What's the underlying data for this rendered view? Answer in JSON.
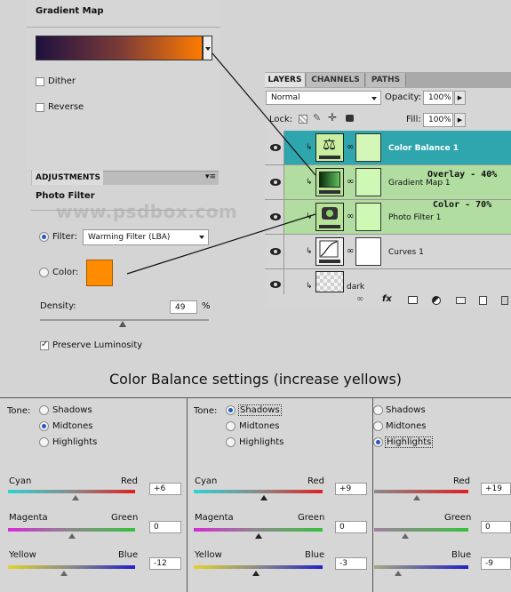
{
  "gradient_map": {
    "title": "Gradient Map",
    "dither_label": "Dither",
    "reverse_label": "Reverse",
    "gradient_colors": [
      "#1e1040",
      "#ff7a00"
    ]
  },
  "adjustments": {
    "tab_label": "ADJUSTMENTS",
    "title": "Photo Filter",
    "watermark": "www.psdbox.com",
    "filter_label": "Filter:",
    "filter_value": "Warming Filter (LBA)",
    "color_label": "Color:",
    "filter_color": "#ff8c00",
    "density_label": "Density:",
    "density_value": "49",
    "density_unit": "%",
    "preserve_label": "Preserve Luminosity"
  },
  "layers_panel": {
    "tabs": [
      "LAYERS",
      "CHANNELS",
      "PATHS"
    ],
    "blend_mode": "Normal",
    "opacity_label": "Opacity:",
    "opacity_value": "100%",
    "lock_label": "Lock:",
    "fill_label": "Fill:",
    "fill_value": "100%",
    "layers": [
      {
        "name": "Color Balance 1",
        "note": ""
      },
      {
        "name": "Gradient Map 1",
        "note": "Overlay - 40%"
      },
      {
        "name": "Photo Filter 1",
        "note": "Color - 70%"
      },
      {
        "name": "Curves 1",
        "note": ""
      },
      {
        "name": "dark",
        "note": ""
      }
    ]
  },
  "color_balance": {
    "heading": "Color Balance settings (increase yellows)",
    "tone_label": "Tone:",
    "tones": [
      "Shadows",
      "Midtones",
      "Highlights"
    ],
    "labels": {
      "cyan": "Cyan",
      "red": "Red",
      "magenta": "Magenta",
      "green": "Green",
      "yellow": "Yellow",
      "blue": "Blue"
    },
    "panels": [
      {
        "selected_tone": "Midtones",
        "cyan_red": "+6",
        "magenta_green": "0",
        "yellow_blue": "-12"
      },
      {
        "selected_tone": "Shadows",
        "cyan_red": "+9",
        "magenta_green": "0",
        "yellow_blue": "-3"
      },
      {
        "selected_tone": "Highlights",
        "cyan_red": "+19",
        "magenta_green": "0",
        "yellow_blue": "-9"
      }
    ]
  }
}
